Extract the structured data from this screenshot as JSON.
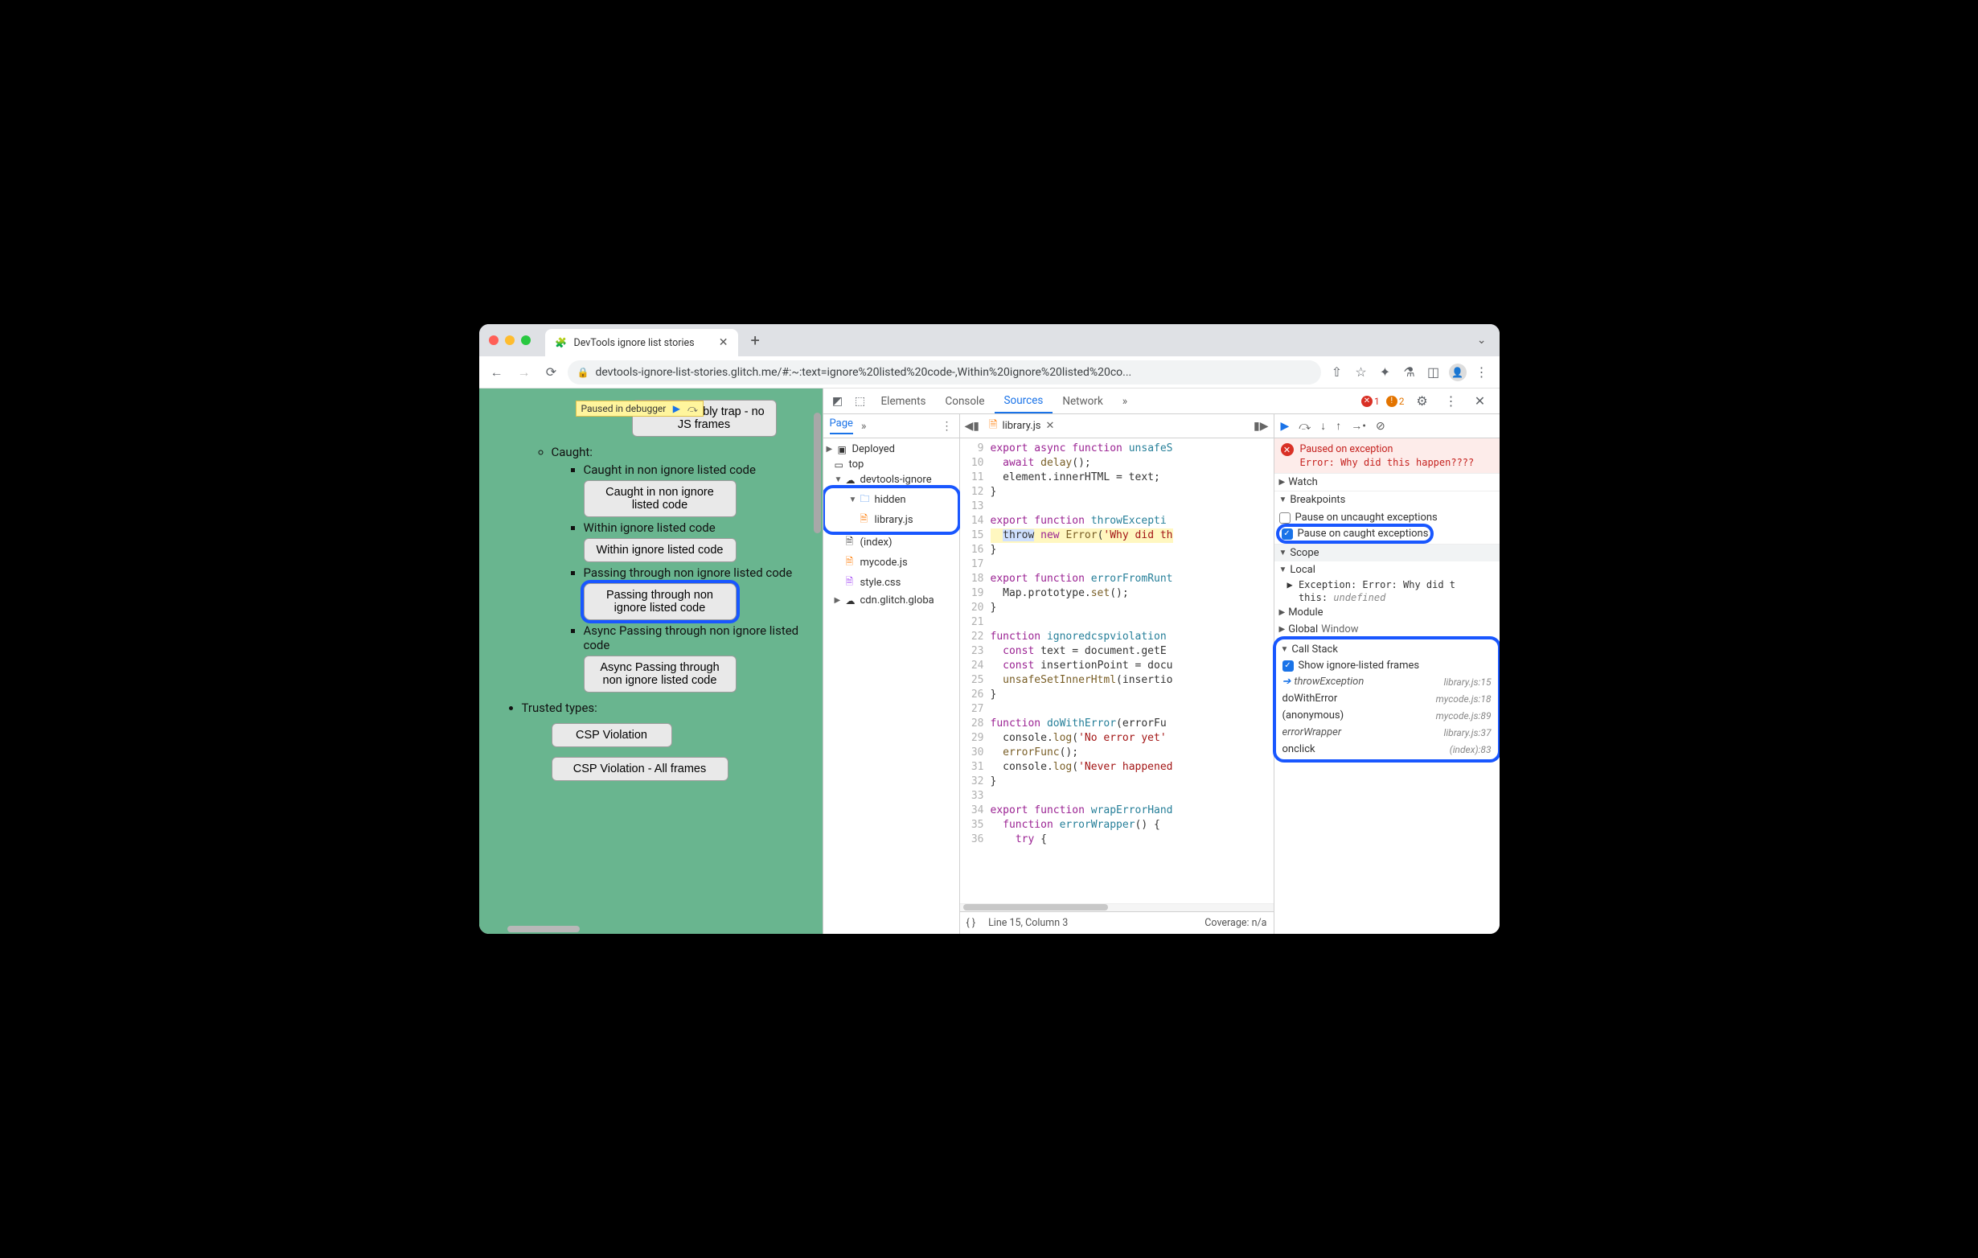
{
  "browser": {
    "tab_title": "DevTools ignore list stories",
    "url": "devtools-ignore-list-stories.glitch.me/#:~:text=ignore%20listed%20code-,Within%20ignore%20listed%20co...",
    "paused_badge": "Paused in debugger"
  },
  "page": {
    "wasm_btn": "WebAssembly trap - no JS frames",
    "caught_label": "Caught:",
    "items": [
      {
        "label": "Caught in non ignore listed code",
        "btn": "Caught in non ignore listed code"
      },
      {
        "label": "Within ignore listed code",
        "btn": "Within ignore listed code"
      },
      {
        "label": "Passing through non ignore listed code",
        "btn": "Passing through non ignore listed code",
        "hl": true
      },
      {
        "label": "Async Passing through non ignore listed code",
        "btn": "Async Passing through non ignore listed code"
      }
    ],
    "trusted_label": "Trusted types:",
    "csp1": "CSP Violation",
    "csp2": "CSP Violation - All frames"
  },
  "devtools": {
    "tabs": [
      "Elements",
      "Console",
      "Sources",
      "Network"
    ],
    "active_tab": "Sources",
    "errors": "1",
    "warnings": "2",
    "nav": {
      "page": "Page",
      "deployed": "Deployed",
      "top": "top",
      "domain": "devtools-ignore",
      "hidden": "hidden",
      "libjs": "library.js",
      "index": "(index)",
      "mycode": "mycode.js",
      "style": "style.css",
      "cdn": "cdn.glitch.globa"
    },
    "editor": {
      "filename": "library.js",
      "first_line": 9,
      "status_line": "Line 15, Column 3",
      "coverage": "Coverage: n/a",
      "lines": [
        {
          "n": 9,
          "html": "<span class='tok-kw'>export</span> <span class='tok-kw'>async</span> <span class='tok-kw'>function</span> <span class='tok-def'>unsafeS</span>"
        },
        {
          "n": 10,
          "html": "  <span class='tok-kw'>await</span> <span class='tok-fn'>delay</span>();"
        },
        {
          "n": 11,
          "html": "  element.innerHTML = text;"
        },
        {
          "n": 12,
          "html": "}"
        },
        {
          "n": 13,
          "html": ""
        },
        {
          "n": 14,
          "html": "<span class='tok-kw'>export</span> <span class='tok-kw'>function</span> <span class='tok-def'>throwExcepti</span>"
        },
        {
          "n": 15,
          "html": "<span class='hl-line'>  <span class='hl-throw'>throw</span> <span class='tok-kw'>new</span> <span class='tok-fn'>Error</span>(<span class='tok-str'>'Why did th</span></span>"
        },
        {
          "n": 16,
          "html": "}"
        },
        {
          "n": 17,
          "html": ""
        },
        {
          "n": 18,
          "html": "<span class='tok-kw'>export</span> <span class='tok-kw'>function</span> <span class='tok-def'>errorFromRunt</span>"
        },
        {
          "n": 19,
          "html": "  Map.prototype.<span class='tok-fn'>set</span>();"
        },
        {
          "n": 20,
          "html": "}"
        },
        {
          "n": 21,
          "html": ""
        },
        {
          "n": 22,
          "html": "<span class='tok-kw'>function</span> <span class='tok-def'>ignoredcspviolation</span>"
        },
        {
          "n": 23,
          "html": "  <span class='tok-kw'>const</span> text = document.getE"
        },
        {
          "n": 24,
          "html": "  <span class='tok-kw'>const</span> insertionPoint = docu"
        },
        {
          "n": 25,
          "html": "  <span class='tok-fn'>unsafeSetInnerHtml</span>(insertio"
        },
        {
          "n": 26,
          "html": "}"
        },
        {
          "n": 27,
          "html": ""
        },
        {
          "n": 28,
          "html": "<span class='tok-kw'>function</span> <span class='tok-def'>doWithError</span>(errorFu"
        },
        {
          "n": 29,
          "html": "  console.<span class='tok-fn'>log</span>(<span class='tok-str'>'No error yet'</span>"
        },
        {
          "n": 30,
          "html": "  <span class='tok-fn'>errorFunc</span>();"
        },
        {
          "n": 31,
          "html": "  console.<span class='tok-fn'>log</span>(<span class='tok-str'>'Never happened</span>"
        },
        {
          "n": 32,
          "html": "}"
        },
        {
          "n": 33,
          "html": ""
        },
        {
          "n": 34,
          "html": "<span class='tok-kw'>export</span> <span class='tok-kw'>function</span> <span class='tok-def'>wrapErrorHand</span>"
        },
        {
          "n": 35,
          "html": "  <span class='tok-kw'>function</span> <span class='tok-def'>errorWrapper</span>() {"
        },
        {
          "n": 36,
          "html": "    <span class='tok-kw'>try</span> {"
        }
      ]
    },
    "debug": {
      "paused_title": "Paused on exception",
      "paused_err": "Error: Why did this happen????",
      "watch": "Watch",
      "breakpoints": "Breakpoints",
      "bp_uncaught": "Pause on uncaught exceptions",
      "bp_caught": "Pause on caught exceptions",
      "scope": "Scope",
      "scope_local": "Local",
      "scope_exc": "Exception: Error: Why did t",
      "scope_this": "this: ",
      "scope_undef": "undefined",
      "scope_module": "Module",
      "scope_global": "Global",
      "scope_window": "Window",
      "callstack": "Call Stack",
      "show_ignored": "Show ignore-listed frames",
      "frames": [
        {
          "fn": "throwException",
          "loc": "library.js:15",
          "cur": true,
          "ign": true
        },
        {
          "fn": "doWithError",
          "loc": "mycode.js:18"
        },
        {
          "fn": "(anonymous)",
          "loc": "mycode.js:89"
        },
        {
          "fn": "errorWrapper",
          "loc": "library.js:37",
          "ign": true
        },
        {
          "fn": "onclick",
          "loc": "(index):83"
        }
      ]
    }
  }
}
